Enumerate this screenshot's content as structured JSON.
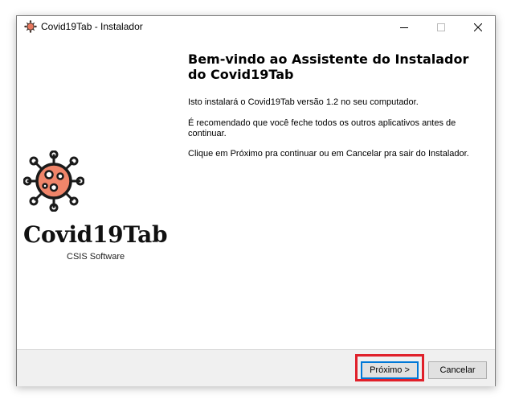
{
  "window": {
    "title": "Covid19Tab - Instalador"
  },
  "logo": {
    "name": "Covid19Tab",
    "subtitle": "CSIS Software",
    "virus_color": "#f0856a",
    "outline_color": "#1a1a1a"
  },
  "main": {
    "heading": "Bem-vindo ao Assistente do Instalador do Covid19Tab",
    "paragraphs": [
      "Isto instalará o Covid19Tab versão 1.2 no seu computador.",
      "É recomendado que você feche todos os outros aplicativos antes de continuar.",
      "Clique em Próximo pra continuar ou em Cancelar pra sair do Instalador."
    ]
  },
  "buttons": {
    "next_label": "Próximo >",
    "cancel_label": "Cancelar"
  },
  "colors": {
    "highlight": "#e0202a",
    "focus_border": "#0078d7"
  }
}
